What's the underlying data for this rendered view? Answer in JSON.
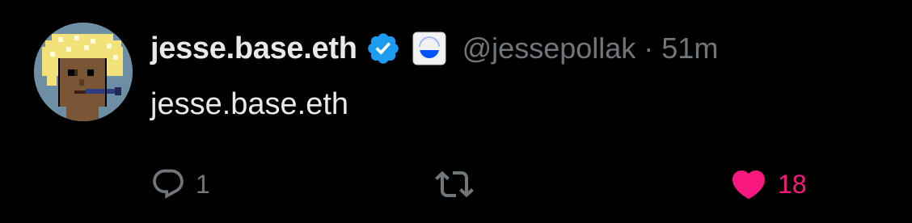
{
  "tweet": {
    "display_name": "jesse.base.eth",
    "handle": "@jessepollak",
    "separator": "·",
    "time_ago": "51m",
    "text": "jesse.base.eth",
    "reply_count": "1",
    "like_count": "18"
  },
  "icons": {
    "verified": "verified-badge-icon",
    "affiliate": "affiliate-badge-icon",
    "reply": "reply-icon",
    "retweet": "retweet-icon",
    "like": "heart-icon"
  },
  "colors": {
    "background": "#000000",
    "text_primary": "#e7e9ea",
    "text_secondary": "#71767b",
    "verified_blue": "#1d9bf0",
    "like_pink": "#f91880"
  }
}
